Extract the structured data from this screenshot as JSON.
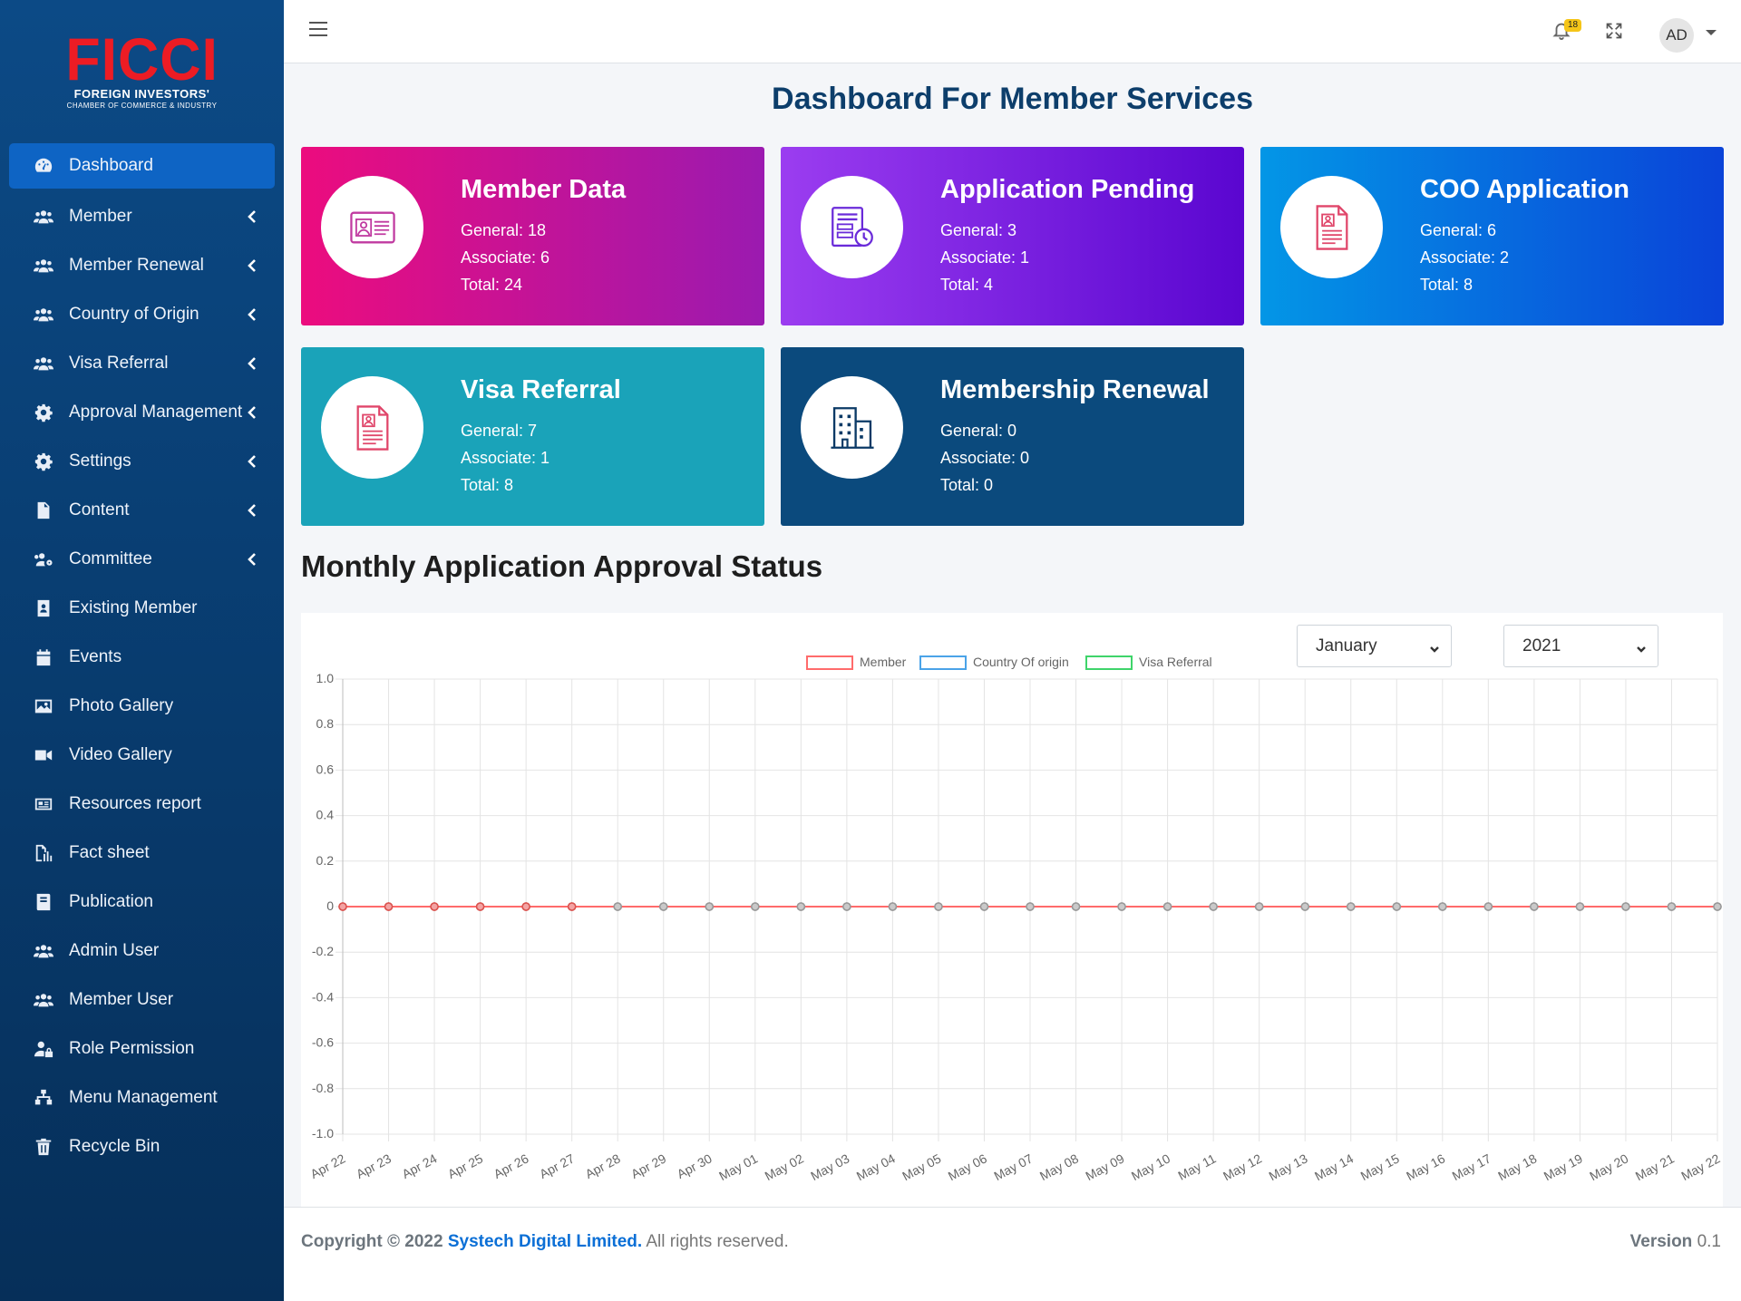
{
  "brand": {
    "word": "FICCI",
    "line1": "FOREIGN INVESTORS'",
    "line2": "CHAMBER OF COMMERCE & INDUSTRY"
  },
  "sidebar": {
    "items": [
      {
        "label": "Dashboard",
        "icon": "dashboard-icon",
        "active": true,
        "submenu": false
      },
      {
        "label": "Member",
        "icon": "users-icon",
        "submenu": true
      },
      {
        "label": "Member Renewal",
        "icon": "users-icon",
        "submenu": true
      },
      {
        "label": "Country of Origin",
        "icon": "users-icon",
        "submenu": true
      },
      {
        "label": "Visa Referral",
        "icon": "users-icon",
        "submenu": true
      },
      {
        "label": "Approval Management",
        "icon": "gear-icon",
        "submenu": true
      },
      {
        "label": "Settings",
        "icon": "gear-icon",
        "submenu": true
      },
      {
        "label": "Content",
        "icon": "file-icon",
        "submenu": true
      },
      {
        "label": "Committee",
        "icon": "users-cog-icon",
        "submenu": true
      },
      {
        "label": "Existing Member",
        "icon": "id-badge-icon",
        "submenu": false
      },
      {
        "label": "Events",
        "icon": "calendar-icon",
        "submenu": false
      },
      {
        "label": "Photo Gallery",
        "icon": "image-icon",
        "submenu": false
      },
      {
        "label": "Video Gallery",
        "icon": "video-icon",
        "submenu": false
      },
      {
        "label": "Resources report",
        "icon": "newspaper-icon",
        "submenu": false
      },
      {
        "label": "Fact sheet",
        "icon": "file-chart-icon",
        "submenu": false
      },
      {
        "label": "Publication",
        "icon": "book-icon",
        "submenu": false
      },
      {
        "label": "Admin User",
        "icon": "users-icon",
        "submenu": false
      },
      {
        "label": "Member User",
        "icon": "users-icon",
        "submenu": false
      },
      {
        "label": "Role Permission",
        "icon": "user-lock-icon",
        "submenu": false
      },
      {
        "label": "Menu Management",
        "icon": "sitemap-icon",
        "submenu": false
      },
      {
        "label": "Recycle Bin",
        "icon": "trash-icon",
        "submenu": false
      }
    ]
  },
  "topbar": {
    "notification_count": "18",
    "user_initials": "AD"
  },
  "page": {
    "title": "Dashboard For Member Services",
    "section_title": "Monthly Application Approval Status"
  },
  "cards": [
    {
      "title": "Member Data",
      "general": "General: 18",
      "associate": "Associate: 6",
      "total": "Total: 24",
      "icon": "id-card-icon"
    },
    {
      "title": "Application Pending",
      "general": "General: 3",
      "associate": "Associate: 1",
      "total": "Total: 4",
      "icon": "pending-form-icon"
    },
    {
      "title": "COO Application",
      "general": "General: 6",
      "associate": "Associate: 2",
      "total": "Total: 8",
      "icon": "resume-doc-icon"
    },
    {
      "title": "Visa Referral",
      "general": "General: 7",
      "associate": "Associate: 1",
      "total": "Total: 8",
      "icon": "resume-doc-icon"
    },
    {
      "title": "Membership Renewal",
      "general": "General: 0",
      "associate": "Associate: 0",
      "total": "Total: 0",
      "icon": "building-icon"
    }
  ],
  "filters": {
    "month": "January",
    "year": "2021"
  },
  "chart_data": {
    "type": "line",
    "x": [
      "Apr 22",
      "Apr 23",
      "Apr 24",
      "Apr 25",
      "Apr 26",
      "Apr 27",
      "Apr 28",
      "Apr 29",
      "Apr 30",
      "May 01",
      "May 02",
      "May 03",
      "May 04",
      "May 05",
      "May 06",
      "May 07",
      "May 08",
      "May 09",
      "May 10",
      "May 11",
      "May 12",
      "May 13",
      "May 14",
      "May 15",
      "May 16",
      "May 17",
      "May 18",
      "May 19",
      "May 20",
      "May 21",
      "May 22"
    ],
    "series": [
      {
        "name": "Member",
        "color": "#ff6b6b",
        "values": [
          0,
          0,
          0,
          0,
          0,
          0,
          0,
          0,
          0,
          0,
          0,
          0,
          0,
          0,
          0,
          0,
          0,
          0,
          0,
          0,
          0,
          0,
          0,
          0,
          0,
          0,
          0,
          0,
          0,
          0,
          0
        ]
      },
      {
        "name": "Country Of origin",
        "color": "#4aa3e8",
        "values": [
          0,
          0,
          0,
          0,
          0,
          0,
          0,
          0,
          0,
          0,
          0,
          0,
          0,
          0,
          0,
          0,
          0,
          0,
          0,
          0,
          0,
          0,
          0,
          0,
          0,
          0,
          0,
          0,
          0,
          0,
          0
        ]
      },
      {
        "name": "Visa Referral",
        "color": "#3fd46a",
        "values": [
          0,
          0,
          0,
          0,
          0,
          0,
          0,
          0,
          0,
          0,
          0,
          0,
          0,
          0,
          0,
          0,
          0,
          0,
          0,
          0,
          0,
          0,
          0,
          0,
          0,
          0,
          0,
          0,
          0,
          0,
          0
        ]
      }
    ],
    "yticks": [
      "1.0",
      "0.8",
      "0.6",
      "0.4",
      "0.2",
      "0",
      "-0.2",
      "-0.4",
      "-0.6",
      "-0.8",
      "-1.0"
    ],
    "ylim": [
      -1,
      1
    ],
    "grid": true,
    "legend": "top-center"
  },
  "footer": {
    "copyright_prefix": "Copyright © 2022 ",
    "company": "Systech Digital Limited.",
    "rights": " All rights reserved.",
    "version_label": "Version",
    "version_value": " 0.1"
  }
}
